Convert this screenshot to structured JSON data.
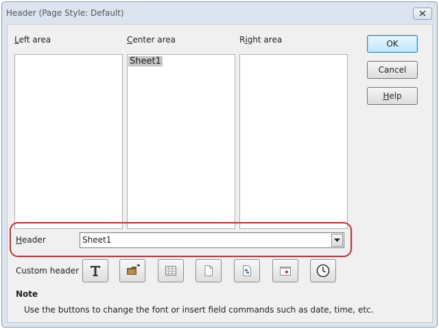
{
  "window": {
    "title": "Header (Page Style: Default)"
  },
  "areas": {
    "left_label": "Left area",
    "center_label": "Center area",
    "right_label": "Right area",
    "center_content": "Sheet1"
  },
  "buttons": {
    "ok": "OK",
    "cancel": "Cancel",
    "help": "Help"
  },
  "header": {
    "label": "Header",
    "value": "Sheet1"
  },
  "custom_header": {
    "label": "Custom header",
    "tools": [
      "text-attributes-icon",
      "file-name-icon",
      "sheet-name-icon",
      "page-icon",
      "pages-icon",
      "date-icon",
      "time-icon"
    ]
  },
  "note": {
    "title": "Note",
    "text": "Use the buttons to change the font or insert field commands such as date, time, etc."
  },
  "colors": {
    "highlight": "#d9262c",
    "selection": "#c6c6c6"
  }
}
